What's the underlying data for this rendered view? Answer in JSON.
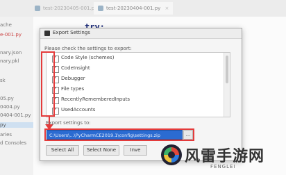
{
  "tabs": [
    {
      "label": "test-20230405-001.py"
    },
    {
      "label": "test-20230404-001.py"
    }
  ],
  "tab_close": "×",
  "filetree": {
    "items": [
      "ache",
      "e-001.py",
      "nary.json",
      "nary.pkl",
      "sk",
      "05.py",
      "0404.py",
      "0404-001.py",
      "py",
      "aries",
      "d Consoles"
    ]
  },
  "editor": {
    "code": "try:"
  },
  "dialog": {
    "title": "Export Settings",
    "message": "Please check the settings to export:",
    "items": [
      {
        "label": "Code Style (schemes)",
        "checked": true
      },
      {
        "label": "CodeInsight",
        "checked": true
      },
      {
        "label": "Debugger",
        "checked": true
      },
      {
        "label": "File types",
        "checked": true
      },
      {
        "label": "RecentlyRememberedInputs",
        "checked": true
      },
      {
        "label": "UsedAccounts",
        "checked": true
      }
    ],
    "export_label": "Export settings to:",
    "path_value": "C:\\Users\\...\\PyCharmCE2019.1\\config\\settings.zip",
    "browse_label": "...",
    "buttons": {
      "select_all": "Select All",
      "select_none": "Select None",
      "invert": "Inve"
    }
  },
  "watermark": {
    "text": "风雷手游网",
    "sub": "FENGLEI"
  },
  "colors": {
    "highlight": "#e43b3b",
    "selection": "#2b6bd1"
  }
}
